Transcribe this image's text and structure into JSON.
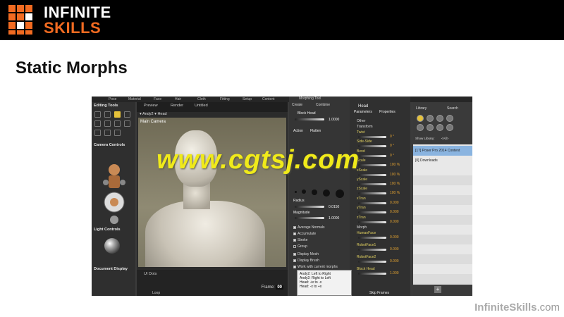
{
  "brand": {
    "line1": "INFINITE",
    "line2": "SKILLS",
    "accent_color": "#f26b21"
  },
  "slide": {
    "title": "Static Morphs"
  },
  "app": {
    "top_tabs": [
      "Pose",
      "Material",
      "Face",
      "Hair",
      "Cloth",
      "Fitting",
      "Setup",
      "Content"
    ],
    "left_panel": {
      "editing_tools": "Editing Tools",
      "camera_controls": "Camera Controls",
      "light_controls": "Light Controls",
      "document_display": "Document Display"
    },
    "viewport": {
      "tabs": [
        "Preview",
        "Render"
      ],
      "doc_title": "Untitled",
      "figure": "Andy2",
      "part": "Head",
      "camera": "Main Camera",
      "ui_dots": "UI Dots",
      "frame_label": "Frame:",
      "frame_value": "00",
      "loop_label": "Loop"
    },
    "morph_tool": {
      "title": "Morphing Tool",
      "tabs": [
        "Create",
        "Combine"
      ],
      "target_label": "Block Head",
      "target_value": "1.0000",
      "action_label": "Action",
      "action_value": "Flatten",
      "radius_label": "Radius",
      "radius_value": "0.0150",
      "magnitude_label": "Magnitude",
      "magnitude_value": "1.0000",
      "options": [
        "Average Normals",
        "Accumulate",
        "Stroke",
        "Group",
        "Display Mesh",
        "Display Brush",
        "Work with current morphs"
      ]
    },
    "parameters": {
      "header": "Head",
      "tabs": [
        "Parameters",
        "Properties"
      ],
      "groups": {
        "other": "Other",
        "transform": "Transform",
        "morph": "Morph"
      },
      "transform_items": [
        {
          "name": "Twist",
          "value": "0 °"
        },
        {
          "name": "Side-Side",
          "value": "0 °"
        },
        {
          "name": "Bend",
          "value": "0 °"
        },
        {
          "name": "Scale",
          "value": "100 %"
        },
        {
          "name": "xScale",
          "value": "100 %"
        },
        {
          "name": "yScale",
          "value": "100 %"
        },
        {
          "name": "zScale",
          "value": "100 %"
        },
        {
          "name": "xTran",
          "value": "0.000"
        },
        {
          "name": "yTran",
          "value": "0.000"
        },
        {
          "name": "zTran",
          "value": "0.000"
        }
      ],
      "morph_items": [
        {
          "name": "HumanFace",
          "value": "0.000"
        },
        {
          "name": "RobotFace1",
          "value": "0.000"
        },
        {
          "name": "RobotFace2",
          "value": "0.000"
        },
        {
          "name": "Block Head",
          "value": "1.000"
        }
      ],
      "skip_frames": "Skip Frames"
    },
    "tooltip": {
      "line1": "Andy2: Left to Right",
      "line2": "Andy2: Right to Left",
      "line3": "Head: +x to -x",
      "line4": "Head: -x to +x"
    },
    "library": {
      "tabs": [
        "Library",
        "Search"
      ],
      "show_label": "Show Library:",
      "show_value": "<All>",
      "rows": [
        {
          "count": "[17]",
          "name": "Poser Pro 2014 Content"
        },
        {
          "count": "[0]",
          "name": "Downloads"
        }
      ]
    }
  },
  "watermark": "www.cgtsj.com",
  "footer": {
    "name": "InfiniteSkills",
    "suffix": ".com"
  }
}
